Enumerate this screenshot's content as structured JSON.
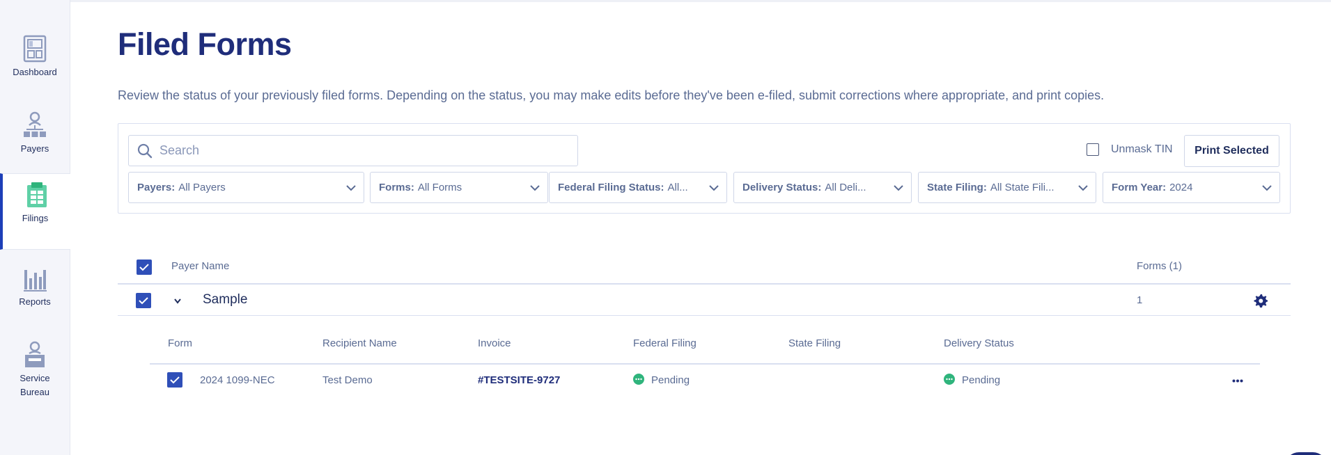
{
  "sidebar": {
    "items": [
      {
        "label": "Dashboard",
        "icon": "dashboard-icon",
        "active": false
      },
      {
        "label": "Payers",
        "icon": "org-chart-icon",
        "active": false
      },
      {
        "label": "Filings",
        "icon": "filings-icon",
        "active": true
      },
      {
        "label": "Reports",
        "icon": "bar-chart-icon",
        "active": false
      },
      {
        "label": "Service Bureau",
        "icon": "service-bureau-icon",
        "active": false
      }
    ]
  },
  "page": {
    "title": "Filed Forms",
    "description": "Review the status of your previously filed forms. Depending on the status, you may make edits before they've been e-filed, submit corrections where appropriate, and print copies."
  },
  "filters": {
    "search_placeholder": "Search",
    "unmask_label": "Unmask TIN",
    "print_label": "Print Selected",
    "dropdowns": [
      {
        "key": "Payers:",
        "value": "All Payers"
      },
      {
        "key": "Forms:",
        "value": "All Forms"
      },
      {
        "key": "Federal Filing Status:",
        "value": "All..."
      },
      {
        "key": "Delivery Status:",
        "value": "All Deli..."
      },
      {
        "key": "State Filing:",
        "value": "All State Fili..."
      },
      {
        "key": "Form Year:",
        "value": "2024"
      }
    ]
  },
  "table": {
    "col_payer_name": "Payer Name",
    "col_forms": "Forms (1)",
    "payer": {
      "name": "Sample",
      "forms_count": "1"
    },
    "sub_columns": [
      "Form",
      "Recipient Name",
      "Invoice",
      "Federal Filing",
      "State Filing",
      "Delivery Status"
    ],
    "rows": [
      {
        "form": "2024 1099-NEC",
        "recipient": "Test Demo",
        "invoice": "#TESTSITE-9727",
        "federal_filing": "Pending",
        "state_filing": "",
        "delivery_status": "Pending"
      }
    ]
  },
  "colors": {
    "brand": "#1f2d7a",
    "accent": "#2f4fb8",
    "status_pending": "#2fb47c",
    "sidebar_bg": "#f4f5fa"
  }
}
